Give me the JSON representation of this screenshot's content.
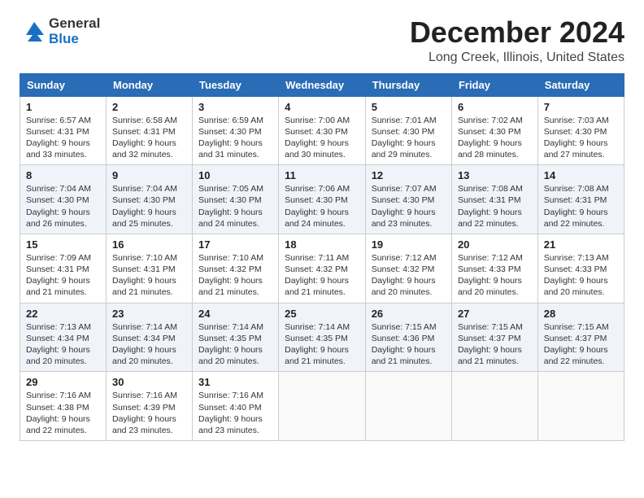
{
  "header": {
    "logo_line1": "General",
    "logo_line2": "Blue",
    "month": "December 2024",
    "location": "Long Creek, Illinois, United States"
  },
  "days_of_week": [
    "Sunday",
    "Monday",
    "Tuesday",
    "Wednesday",
    "Thursday",
    "Friday",
    "Saturday"
  ],
  "weeks": [
    [
      {
        "day": "1",
        "sunrise": "6:57 AM",
        "sunset": "4:31 PM",
        "daylight": "9 hours and 33 minutes."
      },
      {
        "day": "2",
        "sunrise": "6:58 AM",
        "sunset": "4:31 PM",
        "daylight": "9 hours and 32 minutes."
      },
      {
        "day": "3",
        "sunrise": "6:59 AM",
        "sunset": "4:30 PM",
        "daylight": "9 hours and 31 minutes."
      },
      {
        "day": "4",
        "sunrise": "7:00 AM",
        "sunset": "4:30 PM",
        "daylight": "9 hours and 30 minutes."
      },
      {
        "day": "5",
        "sunrise": "7:01 AM",
        "sunset": "4:30 PM",
        "daylight": "9 hours and 29 minutes."
      },
      {
        "day": "6",
        "sunrise": "7:02 AM",
        "sunset": "4:30 PM",
        "daylight": "9 hours and 28 minutes."
      },
      {
        "day": "7",
        "sunrise": "7:03 AM",
        "sunset": "4:30 PM",
        "daylight": "9 hours and 27 minutes."
      }
    ],
    [
      {
        "day": "8",
        "sunrise": "7:04 AM",
        "sunset": "4:30 PM",
        "daylight": "9 hours and 26 minutes."
      },
      {
        "day": "9",
        "sunrise": "7:04 AM",
        "sunset": "4:30 PM",
        "daylight": "9 hours and 25 minutes."
      },
      {
        "day": "10",
        "sunrise": "7:05 AM",
        "sunset": "4:30 PM",
        "daylight": "9 hours and 24 minutes."
      },
      {
        "day": "11",
        "sunrise": "7:06 AM",
        "sunset": "4:30 PM",
        "daylight": "9 hours and 24 minutes."
      },
      {
        "day": "12",
        "sunrise": "7:07 AM",
        "sunset": "4:30 PM",
        "daylight": "9 hours and 23 minutes."
      },
      {
        "day": "13",
        "sunrise": "7:08 AM",
        "sunset": "4:31 PM",
        "daylight": "9 hours and 22 minutes."
      },
      {
        "day": "14",
        "sunrise": "7:08 AM",
        "sunset": "4:31 PM",
        "daylight": "9 hours and 22 minutes."
      }
    ],
    [
      {
        "day": "15",
        "sunrise": "7:09 AM",
        "sunset": "4:31 PM",
        "daylight": "9 hours and 21 minutes."
      },
      {
        "day": "16",
        "sunrise": "7:10 AM",
        "sunset": "4:31 PM",
        "daylight": "9 hours and 21 minutes."
      },
      {
        "day": "17",
        "sunrise": "7:10 AM",
        "sunset": "4:32 PM",
        "daylight": "9 hours and 21 minutes."
      },
      {
        "day": "18",
        "sunrise": "7:11 AM",
        "sunset": "4:32 PM",
        "daylight": "9 hours and 21 minutes."
      },
      {
        "day": "19",
        "sunrise": "7:12 AM",
        "sunset": "4:32 PM",
        "daylight": "9 hours and 20 minutes."
      },
      {
        "day": "20",
        "sunrise": "7:12 AM",
        "sunset": "4:33 PM",
        "daylight": "9 hours and 20 minutes."
      },
      {
        "day": "21",
        "sunrise": "7:13 AM",
        "sunset": "4:33 PM",
        "daylight": "9 hours and 20 minutes."
      }
    ],
    [
      {
        "day": "22",
        "sunrise": "7:13 AM",
        "sunset": "4:34 PM",
        "daylight": "9 hours and 20 minutes."
      },
      {
        "day": "23",
        "sunrise": "7:14 AM",
        "sunset": "4:34 PM",
        "daylight": "9 hours and 20 minutes."
      },
      {
        "day": "24",
        "sunrise": "7:14 AM",
        "sunset": "4:35 PM",
        "daylight": "9 hours and 20 minutes."
      },
      {
        "day": "25",
        "sunrise": "7:14 AM",
        "sunset": "4:35 PM",
        "daylight": "9 hours and 21 minutes."
      },
      {
        "day": "26",
        "sunrise": "7:15 AM",
        "sunset": "4:36 PM",
        "daylight": "9 hours and 21 minutes."
      },
      {
        "day": "27",
        "sunrise": "7:15 AM",
        "sunset": "4:37 PM",
        "daylight": "9 hours and 21 minutes."
      },
      {
        "day": "28",
        "sunrise": "7:15 AM",
        "sunset": "4:37 PM",
        "daylight": "9 hours and 22 minutes."
      }
    ],
    [
      {
        "day": "29",
        "sunrise": "7:16 AM",
        "sunset": "4:38 PM",
        "daylight": "9 hours and 22 minutes."
      },
      {
        "day": "30",
        "sunrise": "7:16 AM",
        "sunset": "4:39 PM",
        "daylight": "9 hours and 23 minutes."
      },
      {
        "day": "31",
        "sunrise": "7:16 AM",
        "sunset": "4:40 PM",
        "daylight": "9 hours and 23 minutes."
      },
      null,
      null,
      null,
      null
    ]
  ]
}
